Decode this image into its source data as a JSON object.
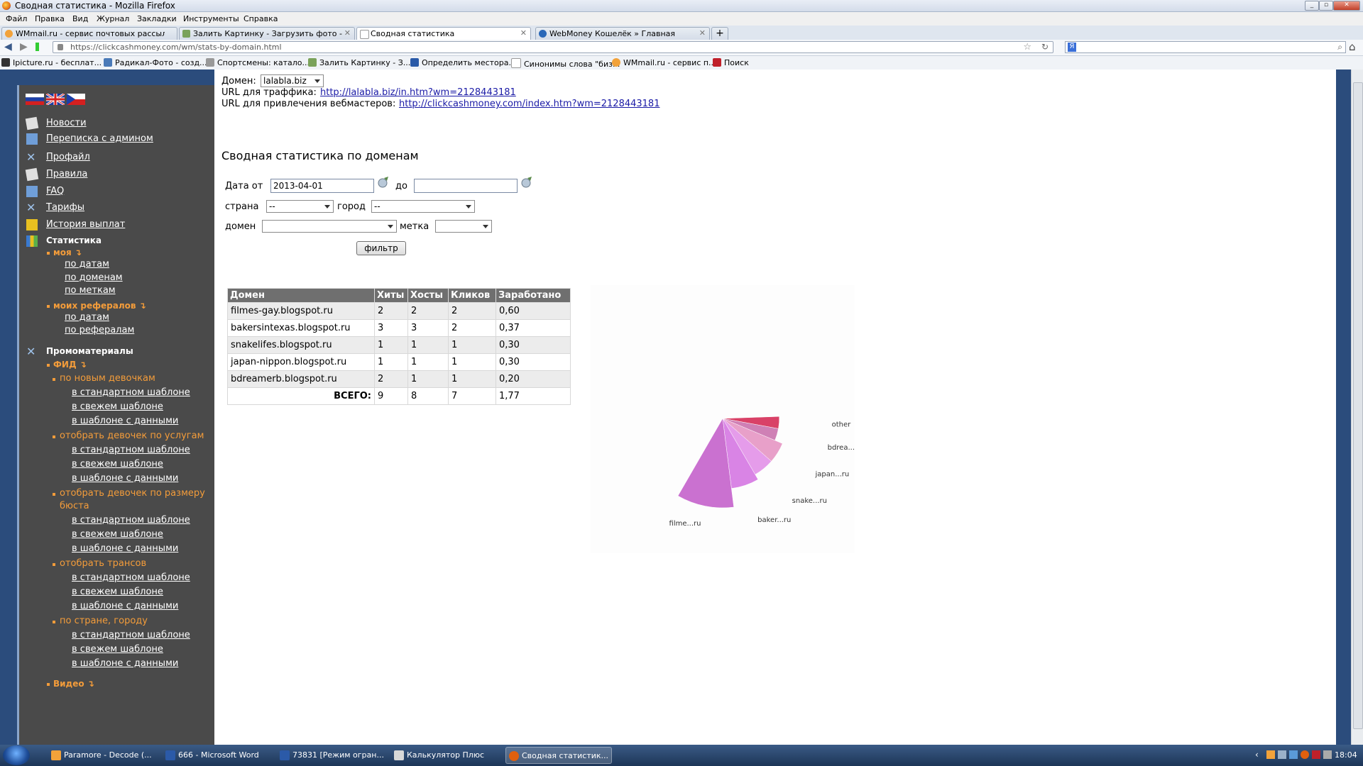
{
  "window": {
    "title": "Сводная статистика - Mozilla Firefox"
  },
  "menu": [
    "Файл",
    "Правка",
    "Вид",
    "Журнал",
    "Закладки",
    "Инструменты",
    "Справка"
  ],
  "tabs": [
    {
      "label": "WMmail.ru - сервис почтовых рассылок...",
      "active": false
    },
    {
      "label": "Залить Картинку - Загрузить фото - Ф...",
      "active": false
    },
    {
      "label": "Сводная статистика",
      "active": true
    },
    {
      "label": "WebMoney Кошелёк » Главная",
      "active": false
    }
  ],
  "address": {
    "url": "https://clickcashmoney.com/wm/stats-by-domain.html"
  },
  "bookmarks": [
    "Ipicture.ru - бесплат...",
    "Радикал-Фото - созд...",
    "Спортсмены: катало...",
    "Залить Картинку - З...",
    "Определить местора...",
    "Синонимы слова \"биз...",
    "WMmail.ru - сервис п...",
    "Поиск"
  ],
  "sidebar": {
    "items": [
      {
        "label": "Новости"
      },
      {
        "label": "Переписка с админом"
      },
      {
        "label": "Профайл"
      },
      {
        "label": "Правила"
      },
      {
        "label": "FAQ"
      },
      {
        "label": "Тарифы"
      },
      {
        "label": "История выплат"
      }
    ],
    "statistics_title": "Статистика",
    "my_label": "моя ↴",
    "my_links": [
      "по датам",
      "по доменам",
      "по меткам"
    ],
    "ref_label": "моих рефералов ↴",
    "ref_links": [
      "по датам",
      "по рефералам"
    ],
    "promo_title": "Промоматериалы",
    "fid_label": "ФИД ↴",
    "promo_groups": [
      {
        "title": "по новым девочкам",
        "links": [
          "в стандартном шаблоне",
          "в свежем шаблоне",
          "в шаблоне с данными"
        ]
      },
      {
        "title": "отобрать девочек по услугам",
        "links": [
          "в стандартном шаблоне",
          "в свежем шаблоне",
          "в шаблоне с данными"
        ]
      },
      {
        "title": "отобрать девочек по размеру",
        "title2": "бюста",
        "links": [
          "в стандартном шаблоне",
          "в свежем шаблоне",
          "в шаблоне с данными"
        ]
      },
      {
        "title": "отобрать трансов",
        "links": [
          "в стандартном шаблоне",
          "в свежем шаблоне",
          "в шаблоне с данными"
        ]
      },
      {
        "title": "по стране, городу",
        "links": [
          "в стандартном шаблоне",
          "в свежем шаблоне",
          "в шаблоне с данными"
        ]
      }
    ],
    "video_label": "Видео ↴"
  },
  "content": {
    "domain_label": "Домен:",
    "domain_value": "lalabla.biz",
    "traffic_label": "URL для траффика:",
    "traffic_url": "http://lalabla.biz/in.htm?wm=2128443181",
    "webmasters_label": "URL для привлечения вебмастеров:",
    "webmasters_url": "http://clickcashmoney.com/index.htm?wm=2128443181",
    "heading": "Сводная статистика по доменам",
    "date_from_label": "Дата от",
    "date_from_value": "2013-04-01",
    "date_to_label": "до",
    "date_to_value": "",
    "country_label": "страна",
    "country_value": "--",
    "city_label": "город",
    "city_value": "--",
    "domain_filter_label": "домен",
    "tag_label": "метка",
    "filter_button": "фильтр"
  },
  "table": {
    "headers": [
      "Домен",
      "Хиты",
      "Хосты",
      "Кликов",
      "Заработано"
    ],
    "rows": [
      [
        "filmes-gay.blogspot.ru",
        "2",
        "2",
        "2",
        "0,60"
      ],
      [
        "bakersintexas.blogspot.ru",
        "3",
        "3",
        "2",
        "0,37"
      ],
      [
        "snakelifes.blogspot.ru",
        "1",
        "1",
        "1",
        "0,30"
      ],
      [
        "japan-nippon.blogspot.ru",
        "1",
        "1",
        "1",
        "0,30"
      ],
      [
        "bdreamerb.blogspot.ru",
        "2",
        "1",
        "1",
        "0,20"
      ]
    ],
    "total_label": "ВСЕГО:",
    "totals": [
      "9",
      "8",
      "7",
      "1,77"
    ]
  },
  "chart_data": {
    "type": "pie",
    "slices": [
      {
        "label": "other",
        "value": 0.2,
        "color": "#d2204c"
      },
      {
        "label": "bdrea...ru",
        "value": 0.2,
        "color": "#c76aa8"
      },
      {
        "label": "japan...ru",
        "value": 0.3,
        "color": "#e48fbf"
      },
      {
        "label": "snake...ru",
        "value": 0.3,
        "color": "#e08be6"
      },
      {
        "label": "baker...ru",
        "value": 0.37,
        "color": "#d26ee0"
      },
      {
        "label": "filme...ru",
        "value": 0.6,
        "color": "#c158c8"
      }
    ]
  },
  "taskbar": {
    "items": [
      "Paramore - Decode (...",
      "666 - Microsoft Word",
      "73831 [Режим огран...",
      "Калькулятор Плюс",
      "Сводная статистик..."
    ],
    "clock": "18:04"
  }
}
